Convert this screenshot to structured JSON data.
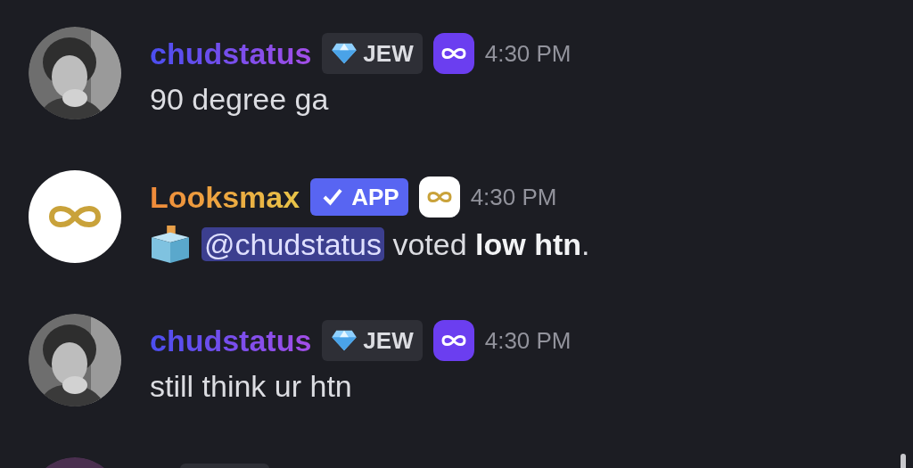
{
  "messages": [
    {
      "kind": "user",
      "author": "chudstatus",
      "tag": {
        "kind": "diamond",
        "label": "JEW"
      },
      "app_badge": {
        "color": "#6b3ef0"
      },
      "time": "4:30 PM",
      "text": "90 degree ga"
    },
    {
      "kind": "app",
      "author": "Looksmax",
      "tag": {
        "kind": "verified",
        "label": "APP"
      },
      "app_badge": {
        "color": "#ffffff"
      },
      "time": "4:30 PM",
      "mention": "@chudstatus",
      "text": "voted **low htn**."
    },
    {
      "kind": "user",
      "author": "chudstatus",
      "tag": {
        "kind": "diamond",
        "label": "JEW"
      },
      "app_badge": {
        "color": "#6b3ef0"
      },
      "time": "4:30 PM",
      "text": "still think ur htn"
    }
  ]
}
